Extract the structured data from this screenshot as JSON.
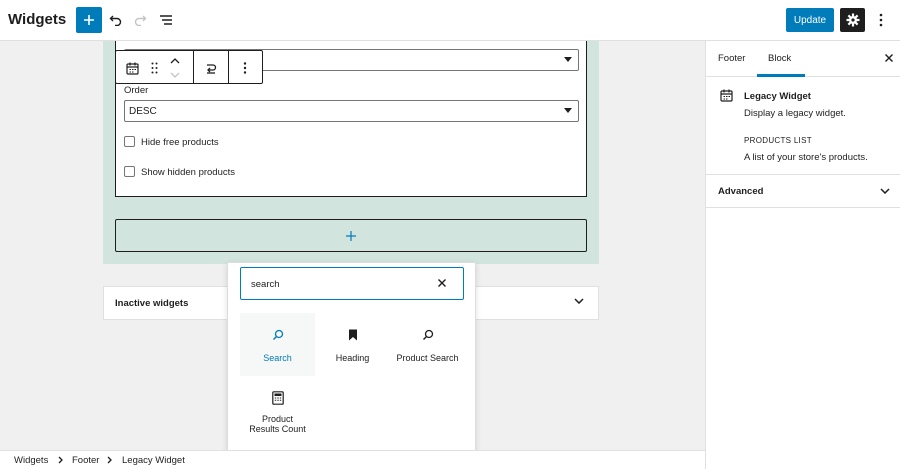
{
  "header": {
    "title": "Widgets",
    "update_label": "Update"
  },
  "widget": {
    "order_label": "Order",
    "order_value": "DESC",
    "hide_free_label": "Hide free products",
    "show_hidden_label": "Show hidden products"
  },
  "inactive": {
    "title": "Inactive widgets"
  },
  "inserter": {
    "search_value": "search",
    "items": [
      {
        "label": "Search",
        "icon": "search-icon"
      },
      {
        "label": "Heading",
        "icon": "bookmark-icon"
      },
      {
        "label": "Product Search",
        "icon": "search-icon"
      },
      {
        "label": "Product Results Count",
        "icon": "calculator-icon"
      }
    ]
  },
  "sidebar": {
    "tabs": [
      "Footer",
      "Block"
    ],
    "block_title": "Legacy Widget",
    "block_desc": "Display a legacy widget.",
    "widget_name": "PRODUCTS LIST",
    "widget_desc": "A list of your store's products.",
    "advanced_label": "Advanced"
  },
  "breadcrumb": [
    "Widgets",
    "Footer",
    "Legacy Widget"
  ],
  "colors": {
    "accent": "#007cba",
    "widget_area_bg": "#d1e4dd",
    "dark": "#1e1e1e"
  }
}
